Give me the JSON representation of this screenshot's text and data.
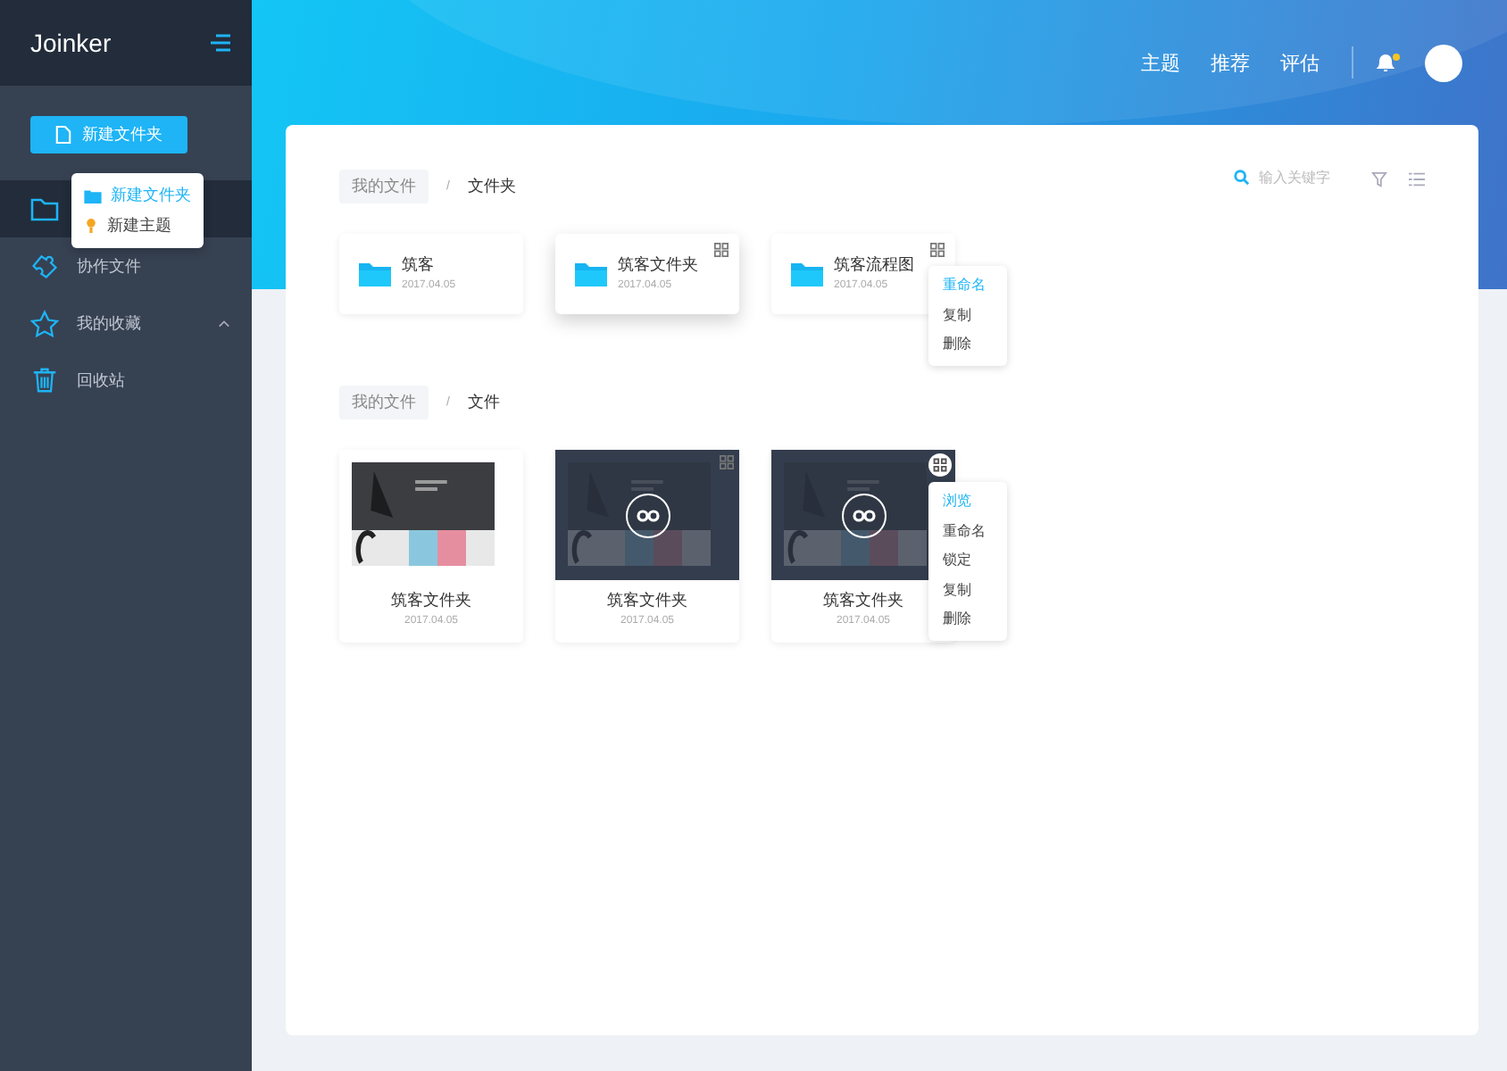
{
  "sidebar": {
    "logo": "Joinker",
    "new_button": "新建文件夹",
    "new_menu": [
      {
        "label": "新建文件夹",
        "kind": "folder",
        "selected": true
      },
      {
        "label": "新建主题",
        "kind": "idea",
        "selected": false
      }
    ],
    "items": [
      {
        "kind": "folder",
        "selected": true
      },
      {
        "kind": "puzzle",
        "label": "协作文件",
        "selected": false
      },
      {
        "kind": "star",
        "label": "我的收藏",
        "selected": false,
        "expanded": true
      },
      {
        "kind": "trash",
        "label": "回收站",
        "selected": false
      }
    ]
  },
  "header": {
    "nav": [
      "主题",
      "推荐",
      "评估"
    ],
    "has_notification": true
  },
  "search": {
    "placeholder": "输入关键字"
  },
  "sections": [
    {
      "kind": "folders",
      "breadcrumb": [
        "我的文件",
        "文件夹"
      ],
      "separator": "/",
      "items": [
        {
          "name": "筑客",
          "date": "2017.04.05",
          "hovered": false
        },
        {
          "name": "筑客文件夹",
          "date": "2017.04.05",
          "hovered": true
        },
        {
          "name": "筑客流程图",
          "date": "2017.04.05",
          "hovered": false,
          "menu": [
            {
              "label": "重命名",
              "selected": true
            },
            {
              "label": "复制",
              "selected": false
            },
            {
              "label": "删除",
              "selected": false
            }
          ]
        }
      ]
    },
    {
      "kind": "files",
      "breadcrumb": [
        "我的文件",
        "文件"
      ],
      "separator": "/",
      "items": [
        {
          "name": "筑客文件夹",
          "date": "2017.04.05",
          "hovered": false
        },
        {
          "name": "筑客文件夹",
          "date": "2017.04.05",
          "hovered": true
        },
        {
          "name": "筑客文件夹",
          "date": "2017.04.05",
          "hovered": true,
          "menu": [
            {
              "label": "浏览",
              "selected": true
            },
            {
              "label": "重命名",
              "selected": false
            },
            {
              "label": "锁定",
              "selected": false
            },
            {
              "label": "复制",
              "selected": false
            },
            {
              "label": "删除",
              "selected": false
            }
          ]
        }
      ]
    }
  ]
}
